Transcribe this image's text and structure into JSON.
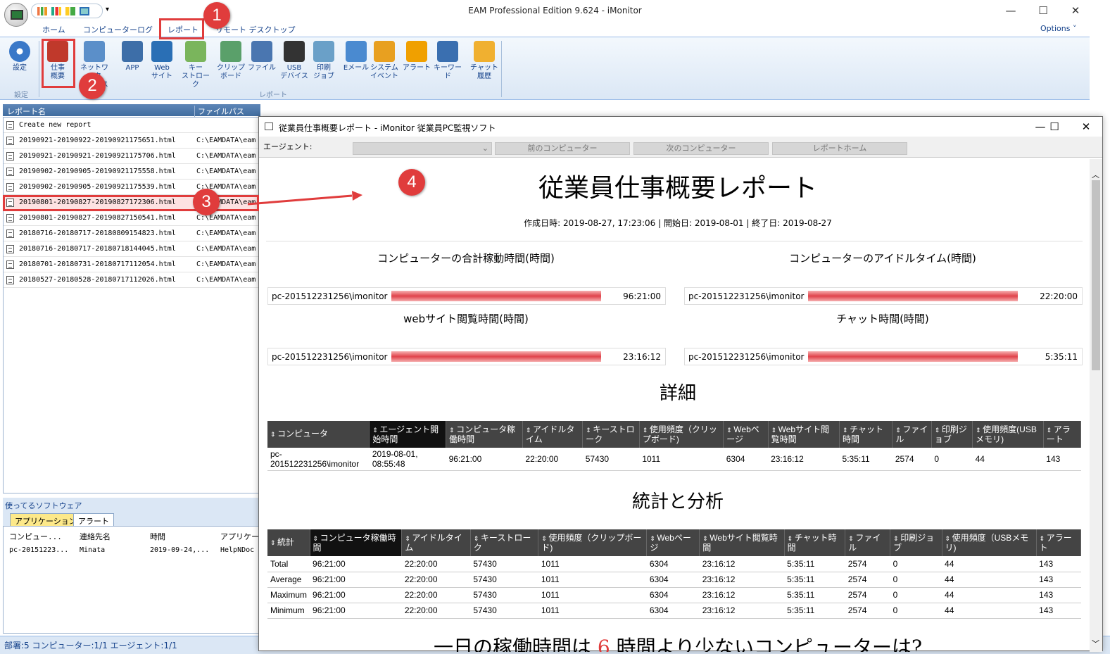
{
  "window": {
    "title": "EAM Professional Edition 9.624 - iMonitor",
    "minimize": "—",
    "maximize": "☐",
    "close": "✕"
  },
  "ribbon_tabs": [
    "ホーム",
    "コンピューターログ",
    "レポート",
    "リモート デスクトップ"
  ],
  "options_label": "Options ˅",
  "ribbon": {
    "settings_label": "設定",
    "settings_group": "設定",
    "report_group": "レポート",
    "buttons": [
      {
        "label": "仕事\n概要",
        "icon": "work-summary-icon",
        "color": "#c0392b"
      },
      {
        "label": "ネットワーク\nアクセス",
        "icon": "network-icon",
        "color": "#5b8fc9"
      },
      {
        "label": "APP",
        "icon": "app-icon",
        "color": "#3d6ea8"
      },
      {
        "label": "Web\nサイト",
        "icon": "globe-icon",
        "color": "#2a6fb5"
      },
      {
        "label": "キー\nストローク",
        "icon": "keyboard-icon",
        "color": "#7ab55c"
      },
      {
        "label": "クリップ\nボード",
        "icon": "clipboard-icon",
        "color": "#5aa06a"
      },
      {
        "label": "ファイル",
        "icon": "file-icon",
        "color": "#4a76b0"
      },
      {
        "label": "USB\nデバイス",
        "icon": "usb-icon",
        "color": "#333333"
      },
      {
        "label": "印刷\nジョブ",
        "icon": "printer-icon",
        "color": "#6aa0c8"
      },
      {
        "label": "Eメール",
        "icon": "email-icon",
        "color": "#4a8ad0"
      },
      {
        "label": "システム\nイベント",
        "icon": "windows-icon",
        "color": "#e8a020"
      },
      {
        "label": "アラート",
        "icon": "alert-icon",
        "color": "#f0a000"
      },
      {
        "label": "キーワード",
        "icon": "keyword-icon",
        "color": "#3a6fb0"
      },
      {
        "label": "チャット\n履歴",
        "icon": "chat-icon",
        "color": "#f0b030"
      }
    ]
  },
  "report_list": {
    "col_name": "レポート名",
    "col_path": "ファイルパス",
    "rows": [
      {
        "name": "Create new report",
        "path": ""
      },
      {
        "name": "20190921-20190922-20190921175651.html",
        "path": "C:\\EAMDATA\\eam"
      },
      {
        "name": "20190921-20190921-20190921175706.html",
        "path": "C:\\EAMDATA\\eam"
      },
      {
        "name": "20190902-20190905-20190921175558.html",
        "path": "C:\\EAMDATA\\eam"
      },
      {
        "name": "20190902-20190905-20190921175539.html",
        "path": "C:\\EAMDATA\\eam"
      },
      {
        "name": "20190801-20190827-20190827172306.html",
        "path": "C:\\EAMDATA\\eam"
      },
      {
        "name": "20190801-20190827-20190827150541.html",
        "path": "C:\\EAMDATA\\eam"
      },
      {
        "name": "20180716-20180717-20180809154823.html",
        "path": "C:\\EAMDATA\\eam"
      },
      {
        "name": "20180716-20180717-20180718144045.html",
        "path": "C:\\EAMDATA\\eam"
      },
      {
        "name": "20180701-20180731-20180717112054.html",
        "path": "C:\\EAMDATA\\eam"
      },
      {
        "name": "20180527-20180528-20180717112026.html",
        "path": "C:\\EAMDATA\\eam"
      }
    ]
  },
  "software_panel": {
    "title": "使ってるソフトウェア",
    "tabs": [
      "アプリケーション",
      "アラート"
    ],
    "cols": [
      "コンピュー...",
      "連絡先名",
      "時間",
      "アプリケー"
    ],
    "row": [
      "pc-20151223...",
      "Minata",
      "2019-09-24,...",
      "HelpNDoc"
    ]
  },
  "status": "部署:5 コンピューター:1/1 エージェント:1/1",
  "report_window": {
    "title": "従業員仕事概要レポート - iMonitor 従業員PC監視ソフト",
    "agent_label": "エージェント:",
    "prev": "前のコンピューター",
    "next": "次のコンピューター",
    "home": "レポートホーム",
    "heading": "従業員仕事概要レポート",
    "meta": "作成日時: 2019-08-27, 17:23:06 | 開始日: 2019-08-01 | 終了日: 2019-08-27",
    "bars": [
      {
        "title": "コンピューターの合計稼動時間(時間)",
        "label": "pc-201512231256\\imonitor",
        "value": "96:21:00",
        "fraction": 1.0
      },
      {
        "title": "コンピューターのアイドルタイム(時間)",
        "label": "pc-201512231256\\imonitor",
        "value": "22:20:00",
        "fraction": 1.0
      },
      {
        "title": "webサイト閲覧時間(時間)",
        "label": "pc-201512231256\\imonitor",
        "value": "23:16:12",
        "fraction": 1.0
      },
      {
        "title": "チャット時間(時間)",
        "label": "pc-201512231256\\imonitor",
        "value": "5:35:11",
        "fraction": 1.0
      }
    ],
    "detail_heading": "詳細",
    "detail_cols": [
      "コンピュータ",
      "エージェント開始時間",
      "コンピュータ稼働時間",
      "アイドルタイム",
      "キーストローク",
      "使用頻度（クリップボード)",
      "Webページ",
      "Webサイト閲覧時間",
      "チャット時間",
      "ファイル",
      "印刷ジョブ",
      "使用頻度(USBメモリ)",
      "アラート"
    ],
    "detail_row": [
      "pc-201512231256\\imonitor",
      "2019-08-01, 08:55:48",
      "96:21:00",
      "22:20:00",
      "57430",
      "1011",
      "6304",
      "23:16:12",
      "5:35:11",
      "2574",
      "0",
      "44",
      "143"
    ],
    "stats_heading": "統計と分析",
    "stats_cols": [
      "統計",
      "コンピュータ稼働時間",
      "アイドルタイム",
      "キーストローク",
      "使用頻度（クリップボード)",
      "Webページ",
      "Webサイト閲覧時間",
      "チャット時間",
      "ファイル",
      "印刷ジョブ",
      "使用頻度（USBメモリ)",
      "アラート"
    ],
    "stats_rows": [
      [
        "Total",
        "96:21:00",
        "22:20:00",
        "57430",
        "1011",
        "6304",
        "23:16:12",
        "5:35:11",
        "2574",
        "0",
        "44",
        "143"
      ],
      [
        "Average",
        "96:21:00",
        "22:20:00",
        "57430",
        "1011",
        "6304",
        "23:16:12",
        "5:35:11",
        "2574",
        "0",
        "44",
        "143"
      ],
      [
        "Maximum",
        "96:21:00",
        "22:20:00",
        "57430",
        "1011",
        "6304",
        "23:16:12",
        "5:35:11",
        "2574",
        "0",
        "44",
        "143"
      ],
      [
        "Minimum",
        "96:21:00",
        "22:20:00",
        "57430",
        "1011",
        "6304",
        "23:16:12",
        "5:35:11",
        "2574",
        "0",
        "44",
        "143"
      ]
    ],
    "bottom_a": "一日の稼働時間は",
    "bottom_num": "6",
    "bottom_b": "時間より少ないコンピューターは?"
  },
  "callouts": [
    "1",
    "2",
    "3",
    "4"
  ],
  "colors": {
    "accent": "#e03c3c",
    "ribbon_text": "#15428b",
    "table_header": "#444444"
  }
}
